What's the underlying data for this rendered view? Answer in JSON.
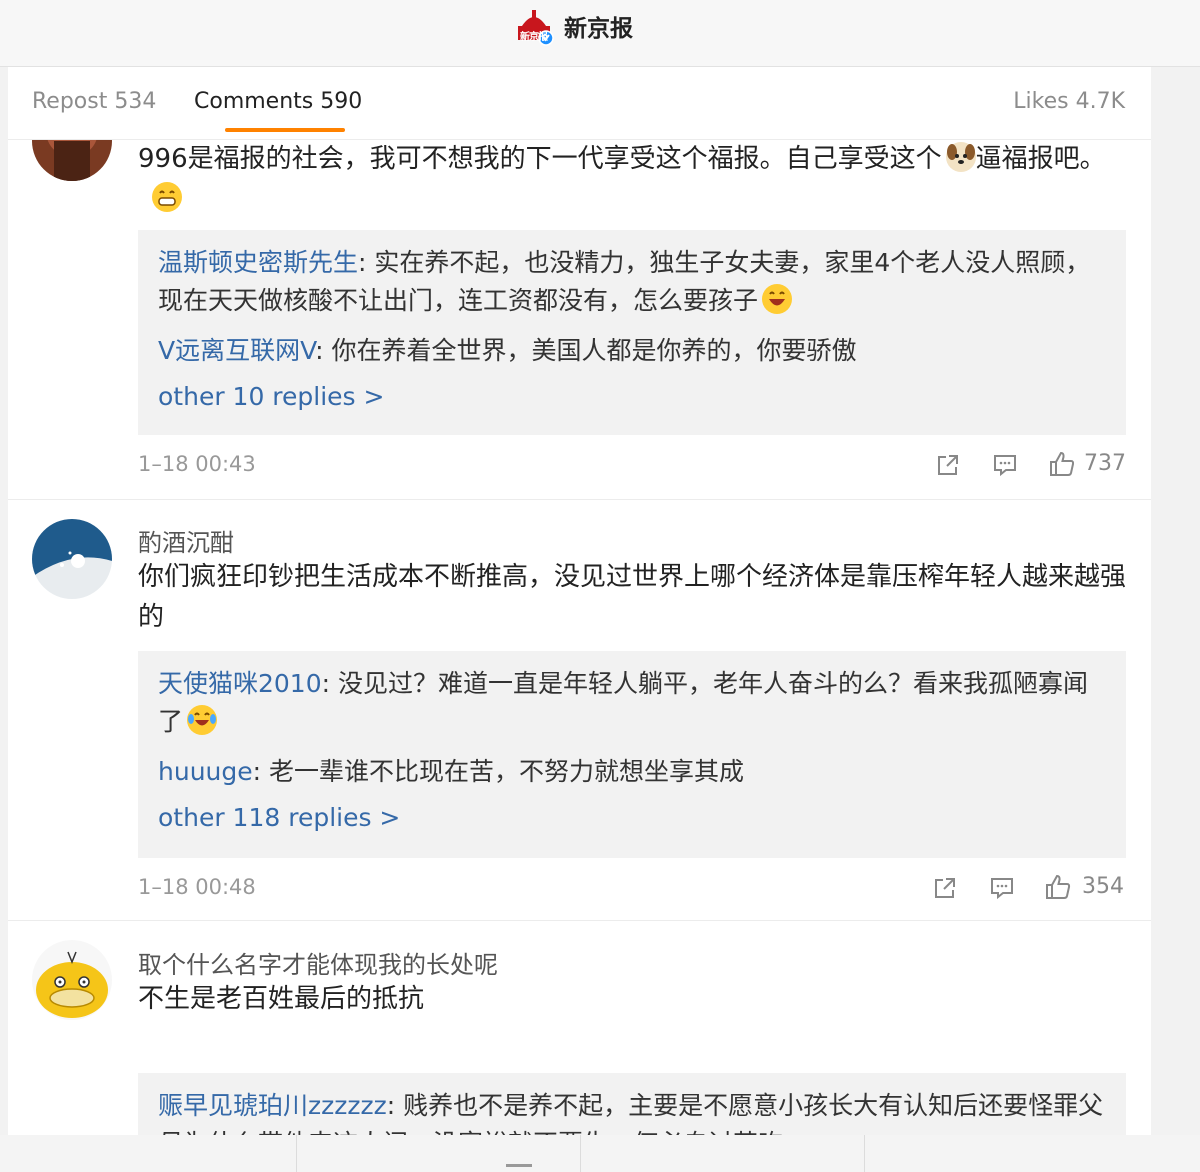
{
  "header": {
    "account_name": "新京报",
    "logo_text": "新京报"
  },
  "tabs": {
    "repost": "Repost 534",
    "comments": "Comments 590",
    "likes": "Likes 4.7K"
  },
  "comments": [
    {
      "username": "",
      "text": "996是福报的社会，我可不想我的下一代享受这个福报。自己享受这个",
      "text_after_dog": "逼福报吧。",
      "replies": [
        {
          "name": "温斯顿史密斯先生",
          "text": ": 实在养不起，也没精力，独生子女夫妻，家里4个老人没人照顾，现在天天做核酸不让出门，连工资都没有，怎么要孩子"
        },
        {
          "name": "V远离互联网V",
          "text": ": 你在养着全世界，美国人都是你养的，你要骄傲"
        }
      ],
      "more": "other 10 replies >",
      "time": "1–18 00:43",
      "likes": "737"
    },
    {
      "username": "酌酒沉酣",
      "text": "你们疯狂印钞把生活成本不断推高，没见过世界上哪个经济体是靠压榨年轻人越来越强的",
      "replies": [
        {
          "name": "天使猫咪2010",
          "text": ": 没见过？难道一直是年轻人躺平，老年人奋斗的么？看来我孤陋寡闻了"
        },
        {
          "name": "huuuge",
          "text": ": 老一辈谁不比现在苦，不努力就想坐享其成"
        }
      ],
      "more": "other 118 replies >",
      "time": "1–18 00:48",
      "likes": "354"
    },
    {
      "username": "取个什么名字才能体现我的长处呢",
      "text": "不生是老百姓最后的抵抗",
      "replies": [
        {
          "name": "赈早见琥珀川zzzzzz",
          "text": ": 贱养也不是养不起，主要是不愿意小孩长大有认知后还要怪罪父母为什么带他来这人间，没富裕就不要生，何必自讨苦吃"
        }
      ]
    }
  ],
  "colors": {
    "accent": "#ff8200",
    "link": "#3569a8",
    "reply_bg": "#f2f2f2"
  },
  "icons": [
    "weibo-verified-logo",
    "repost-icon",
    "comment-icon",
    "thumbs-up-icon",
    "grin-emoji",
    "dog-emoji",
    "laugh-cry-emoji"
  ]
}
